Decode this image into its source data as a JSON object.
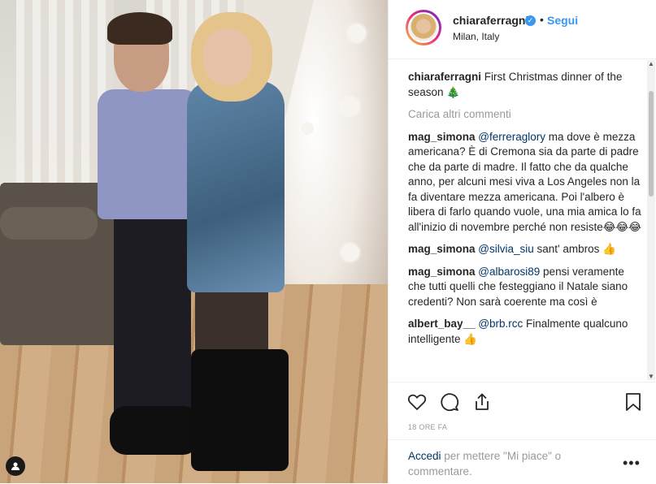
{
  "post": {
    "username": "chiaraferragni",
    "follow_label": "Segui",
    "separator": "•",
    "location": "Milan, Italy",
    "timestamp": "18 ORE FA"
  },
  "caption": {
    "username": "chiaraferragni",
    "text": " First Christmas dinner of the season 🎄"
  },
  "load_more": "Carica altri commenti",
  "comments": [
    {
      "username": "mag_simona",
      "mention": "@ferreraglory",
      "text": " ma dove è mezza americana? È di Cremona sia da parte di padre che da parte di madre. Il fatto che da qualche anno, per alcuni mesi viva a Los Angeles non la fa diventare mezza americana. Poi l'albero è libera di farlo quando vuole, una mia amica lo fa all'inizio di novembre perché non resiste😂😂😂"
    },
    {
      "username": "mag_simona",
      "mention": "@silvia_siu",
      "text": " sant' ambros 👍"
    },
    {
      "username": "mag_simona",
      "mention": "@albarosi89",
      "text": " pensi veramente che tutti quelli che festeggiano il Natale siano credenti? Non sarà coerente ma così è"
    },
    {
      "username": "albert_bay__",
      "mention": "@brb.rcc",
      "text": " Finalmente qualcuno intelligente 👍"
    }
  ],
  "add_comment": {
    "login_link": "Accedi",
    "text": " per mettere \"Mi piace\" o commentare.",
    "more_icon": "more-options-icon"
  },
  "icons": [
    "heart-icon",
    "comment-icon",
    "share-icon",
    "bookmark-icon",
    "verified-icon",
    "user-tag-icon"
  ],
  "colors": {
    "link": "#3897f0",
    "mention": "#003569",
    "muted": "#999999",
    "verified": "#3897f0"
  }
}
